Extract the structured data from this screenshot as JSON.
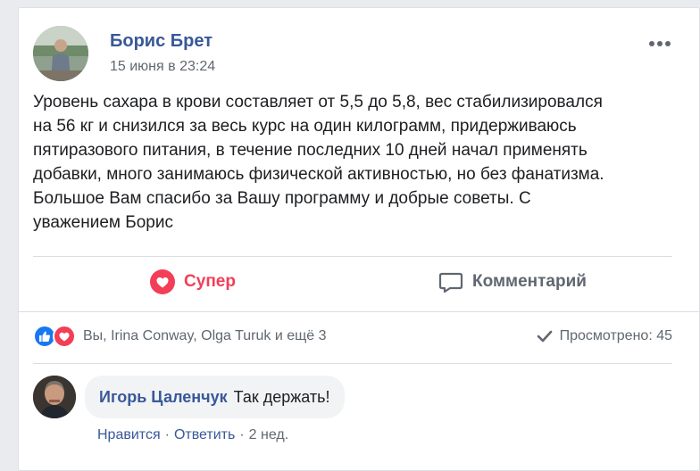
{
  "post": {
    "author": "Борис Брет",
    "time": "15 июня в 23:24",
    "text": "Уровень сахара в крови составляет от 5,5 до 5,8, вес стабилизировался\nна 56 кг и снизился за весь курс на один килограмм, придерживаюсь\nпятиразового питания, в течение последних 10 дней начал применять\nдобавки, много занимаюсь физической активностью, но без фанатизма.\nБольшое Вам спасибо за Вашу программу и добрые советы. С\nуважением Борис"
  },
  "actions": {
    "like_label": "Супер",
    "comment_label": "Комментарий"
  },
  "summary": {
    "reactions_text": "Вы, Irina Conway, Olga Turuk и ещё 3",
    "views_text": "Просмотрено: 45"
  },
  "comment": {
    "author": "Игорь Цаленчук",
    "text": "Так держать!",
    "like_link": "Нравится",
    "reply_link": "Ответить",
    "age": "2 нед.",
    "sep": "·"
  },
  "colors": {
    "link": "#385898",
    "love": "#f33e58",
    "like": "#1877f2",
    "muted": "#606770"
  },
  "icons": [
    "more-options-icon",
    "heart-icon",
    "comment-icon",
    "like-reaction-icon",
    "love-reaction-icon",
    "checkmark-icon"
  ]
}
